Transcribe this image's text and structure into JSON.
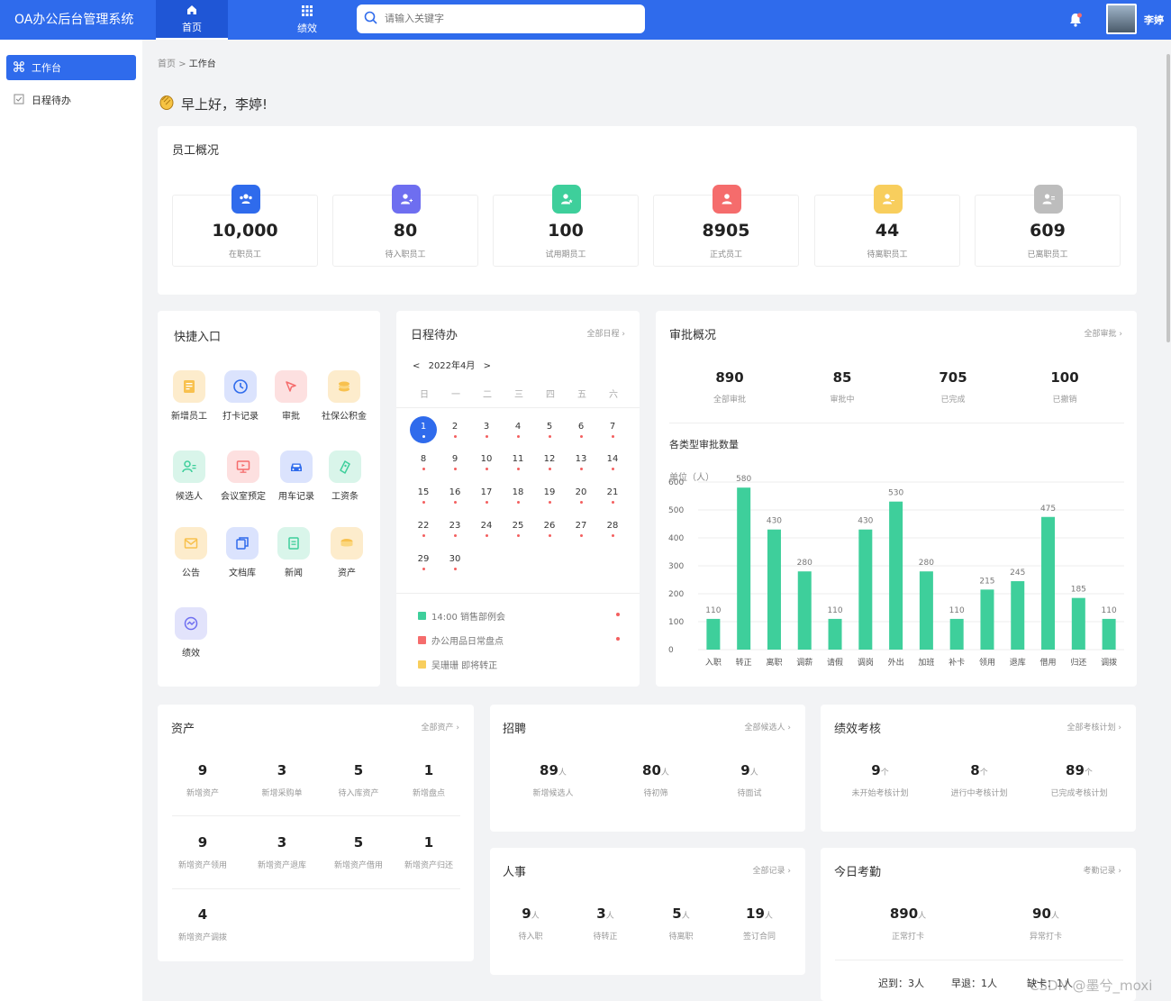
{
  "app": {
    "title": "OA办公后台管理系统",
    "nav": [
      {
        "label": "首页"
      },
      {
        "label": "绩效"
      }
    ],
    "search_placeholder": "请输入关键字",
    "user_name": "李婷"
  },
  "sidebar": {
    "items": [
      {
        "label": "工作台"
      },
      {
        "label": "日程待办"
      }
    ]
  },
  "breadcrumb": {
    "home": "首页",
    "sep": ">",
    "current": "工作台"
  },
  "greeting": "早上好，李婷!",
  "employees": {
    "title": "员工概况",
    "items": [
      {
        "value": "10,000",
        "label": "在职员工",
        "color": "#2f6bec"
      },
      {
        "value": "80",
        "label": "待入职员工",
        "color": "#6e6ef0"
      },
      {
        "value": "100",
        "label": "试用期员工",
        "color": "#3ecf9b"
      },
      {
        "value": "8905",
        "label": "正式员工",
        "color": "#f56c6c"
      },
      {
        "value": "44",
        "label": "待离职员工",
        "color": "#f8ce5d"
      },
      {
        "value": "609",
        "label": "已离职员工",
        "color": "#bdbdbd"
      }
    ]
  },
  "quick": {
    "title": "快捷入口",
    "items": [
      {
        "label": "新增员工",
        "color": "#fdeccc"
      },
      {
        "label": "打卡记录",
        "color": "#dbe3fd"
      },
      {
        "label": "审批",
        "color": "#fde0e0"
      },
      {
        "label": "社保公积金",
        "color": "#fdeccc"
      },
      {
        "label": "候选人",
        "color": "#d9f5ea"
      },
      {
        "label": "会议室预定",
        "color": "#fde0e0"
      },
      {
        "label": "用车记录",
        "color": "#dbe3fd"
      },
      {
        "label": "工资条",
        "color": "#d9f5ea"
      },
      {
        "label": "公告",
        "color": "#fdeccc"
      },
      {
        "label": "文档库",
        "color": "#dbe3fd"
      },
      {
        "label": "新闻",
        "color": "#d9f5ea"
      },
      {
        "label": "资产",
        "color": "#fdeccc"
      },
      {
        "label": "绩效",
        "color": "#e2e3fb"
      }
    ]
  },
  "schedule": {
    "title": "日程待办",
    "more": "全部日程",
    "prev": "<",
    "month": "2022年4月",
    "next": ">",
    "weekdays": [
      "日",
      "一",
      "二",
      "三",
      "四",
      "五",
      "六"
    ],
    "days": [
      "1",
      "2",
      "3",
      "4",
      "5",
      "6",
      "7",
      "8",
      "9",
      "10",
      "11",
      "12",
      "13",
      "14",
      "15",
      "16",
      "17",
      "18",
      "19",
      "20",
      "21",
      "22",
      "23",
      "24",
      "25",
      "26",
      "27",
      "28",
      "29",
      "30"
    ],
    "selected_day": "1",
    "events": [
      {
        "text": "14:00 销售部例会",
        "color": "#3ecf9b"
      },
      {
        "text": "办公用品日常盘点",
        "color": "#f56c6c"
      },
      {
        "text": "吴珊珊 即将转正",
        "color": "#f8ce5d"
      }
    ]
  },
  "approval": {
    "title": "审批概况",
    "more": "全部审批",
    "stats": [
      {
        "value": "890",
        "label": "全部审批"
      },
      {
        "value": "85",
        "label": "审批中"
      },
      {
        "value": "705",
        "label": "已完成"
      },
      {
        "value": "100",
        "label": "已撤销"
      }
    ]
  },
  "chart_data": {
    "type": "bar",
    "title": "各类型审批数量",
    "ylabel": "单位（人）",
    "categories": [
      "入职",
      "转正",
      "离职",
      "调薪",
      "请假",
      "调岗",
      "外出",
      "加班",
      "补卡",
      "领用",
      "退库",
      "借用",
      "归还",
      "调拨"
    ],
    "values": [
      110,
      580,
      430,
      280,
      110,
      430,
      530,
      280,
      110,
      215,
      245,
      475,
      185,
      110
    ],
    "ylim": [
      0,
      600
    ],
    "yticks": [
      0,
      100,
      200,
      300,
      400,
      500,
      600
    ],
    "color": "#3ecf9b",
    "grid": true
  },
  "assets": {
    "title": "资产",
    "more": "全部资产",
    "items": [
      {
        "value": "9",
        "label": "新增资产"
      },
      {
        "value": "3",
        "label": "新增采购单"
      },
      {
        "value": "5",
        "label": "待入库资产"
      },
      {
        "value": "1",
        "label": "新增盘点"
      },
      {
        "value": "9",
        "label": "新增资产领用"
      },
      {
        "value": "3",
        "label": "新增资产退库"
      },
      {
        "value": "5",
        "label": "新增资产借用"
      },
      {
        "value": "1",
        "label": "新增资产归还"
      },
      {
        "value": "4",
        "label": "新增资产调拨"
      }
    ]
  },
  "recruit": {
    "title": "招聘",
    "more": "全部候选人",
    "items": [
      {
        "value": "89",
        "unit": "人",
        "label": "新增候选人"
      },
      {
        "value": "80",
        "unit": "人",
        "label": "待初筛"
      },
      {
        "value": "9",
        "unit": "人",
        "label": "待面试"
      }
    ]
  },
  "perf": {
    "title": "绩效考核",
    "more": "全部考核计划",
    "items": [
      {
        "value": "9",
        "unit": "个",
        "label": "未开始考核计划"
      },
      {
        "value": "8",
        "unit": "个",
        "label": "进行中考核计划"
      },
      {
        "value": "89",
        "unit": "个",
        "label": "已完成考核计划"
      }
    ]
  },
  "hr": {
    "title": "人事",
    "more": "全部记录",
    "items": [
      {
        "value": "9",
        "unit": "人",
        "label": "待入职"
      },
      {
        "value": "3",
        "unit": "人",
        "label": "待转正"
      },
      {
        "value": "5",
        "unit": "人",
        "label": "待离职"
      },
      {
        "value": "19",
        "unit": "人",
        "label": "签订合同"
      }
    ]
  },
  "attendance": {
    "title": "今日考勤",
    "more": "考勤记录",
    "items": [
      {
        "value": "890",
        "unit": "人",
        "label": "正常打卡"
      },
      {
        "value": "90",
        "unit": "人",
        "label": "异常打卡"
      }
    ],
    "late": "迟到：3人",
    "early": "早退：1人",
    "absent": "缺卡：1人"
  },
  "watermark": "CSDN @墨兮_moxi"
}
